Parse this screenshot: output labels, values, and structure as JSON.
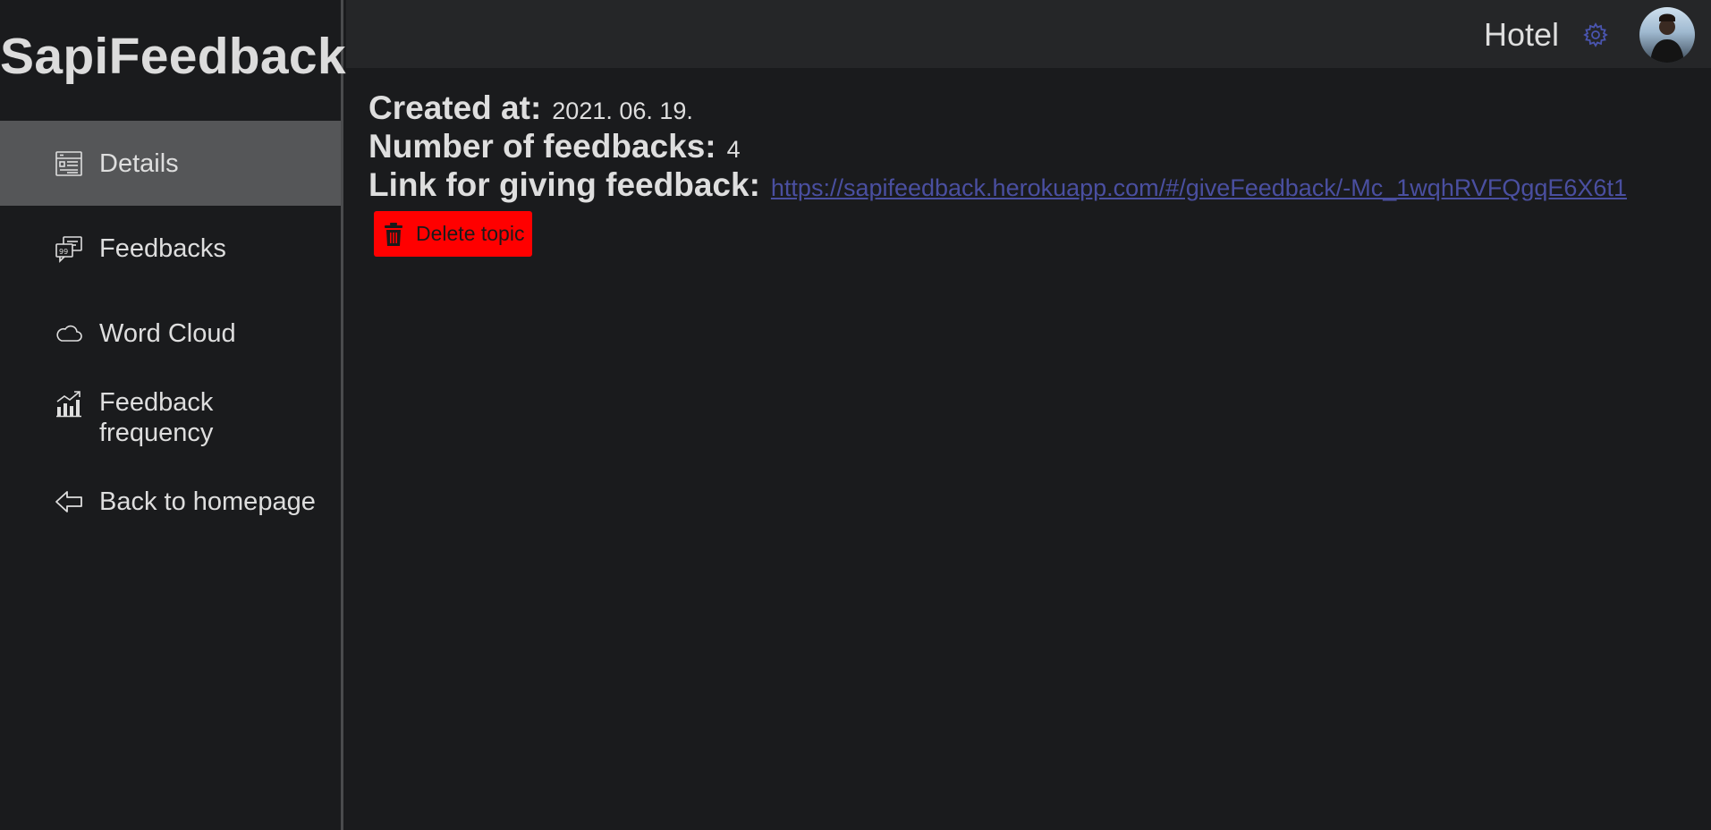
{
  "sidebar": {
    "brand": "SapiFeedback",
    "items": [
      {
        "label": "Details",
        "icon": "details-icon",
        "active": true
      },
      {
        "label": "Feedbacks",
        "icon": "feedbacks-icon"
      },
      {
        "label": "Word Cloud",
        "icon": "cloud-icon"
      },
      {
        "label": "Feedback frequency",
        "icon": "chart-icon"
      },
      {
        "label": "Back to homepage",
        "icon": "arrow-left-icon"
      }
    ]
  },
  "topbar": {
    "topic_name": "Hotel",
    "settings_icon": "gear-icon",
    "avatar_icon": "avatar"
  },
  "details": {
    "created_label": "Created at:",
    "created_value": "2021. 06. 19.",
    "count_label": "Number of feedbacks:",
    "count_value": "4",
    "link_label": "Link for giving feedback:",
    "link_value": "https://sapifeedback.herokuapp.com/#/giveFeedback/-Mc_1wqhRVFQgqE6X6t1",
    "delete_label": "Delete topic"
  },
  "colors": {
    "background": "#1a1b1d",
    "topbar": "#252628",
    "active_nav": "#555658",
    "link": "#4a4fa0",
    "accent_gear": "#4a55b0",
    "delete_button": "#ff0000"
  }
}
